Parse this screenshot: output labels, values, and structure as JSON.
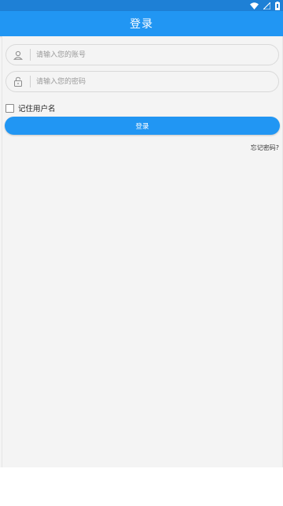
{
  "status_bar": {
    "icons": [
      "wifi-icon",
      "signal-icon",
      "battery-icon"
    ],
    "color": "#1e80d6"
  },
  "header": {
    "title": "登录",
    "color": "#2196f3"
  },
  "form": {
    "account_placeholder": "请输入您的账号",
    "password_placeholder": "请输入您的密码",
    "account_icon": "user-icon",
    "password_icon": "lock-icon",
    "remember_label": "记住用户名",
    "remember_checked": false,
    "login_label": "登录",
    "forgot_label": "忘记密码?"
  }
}
